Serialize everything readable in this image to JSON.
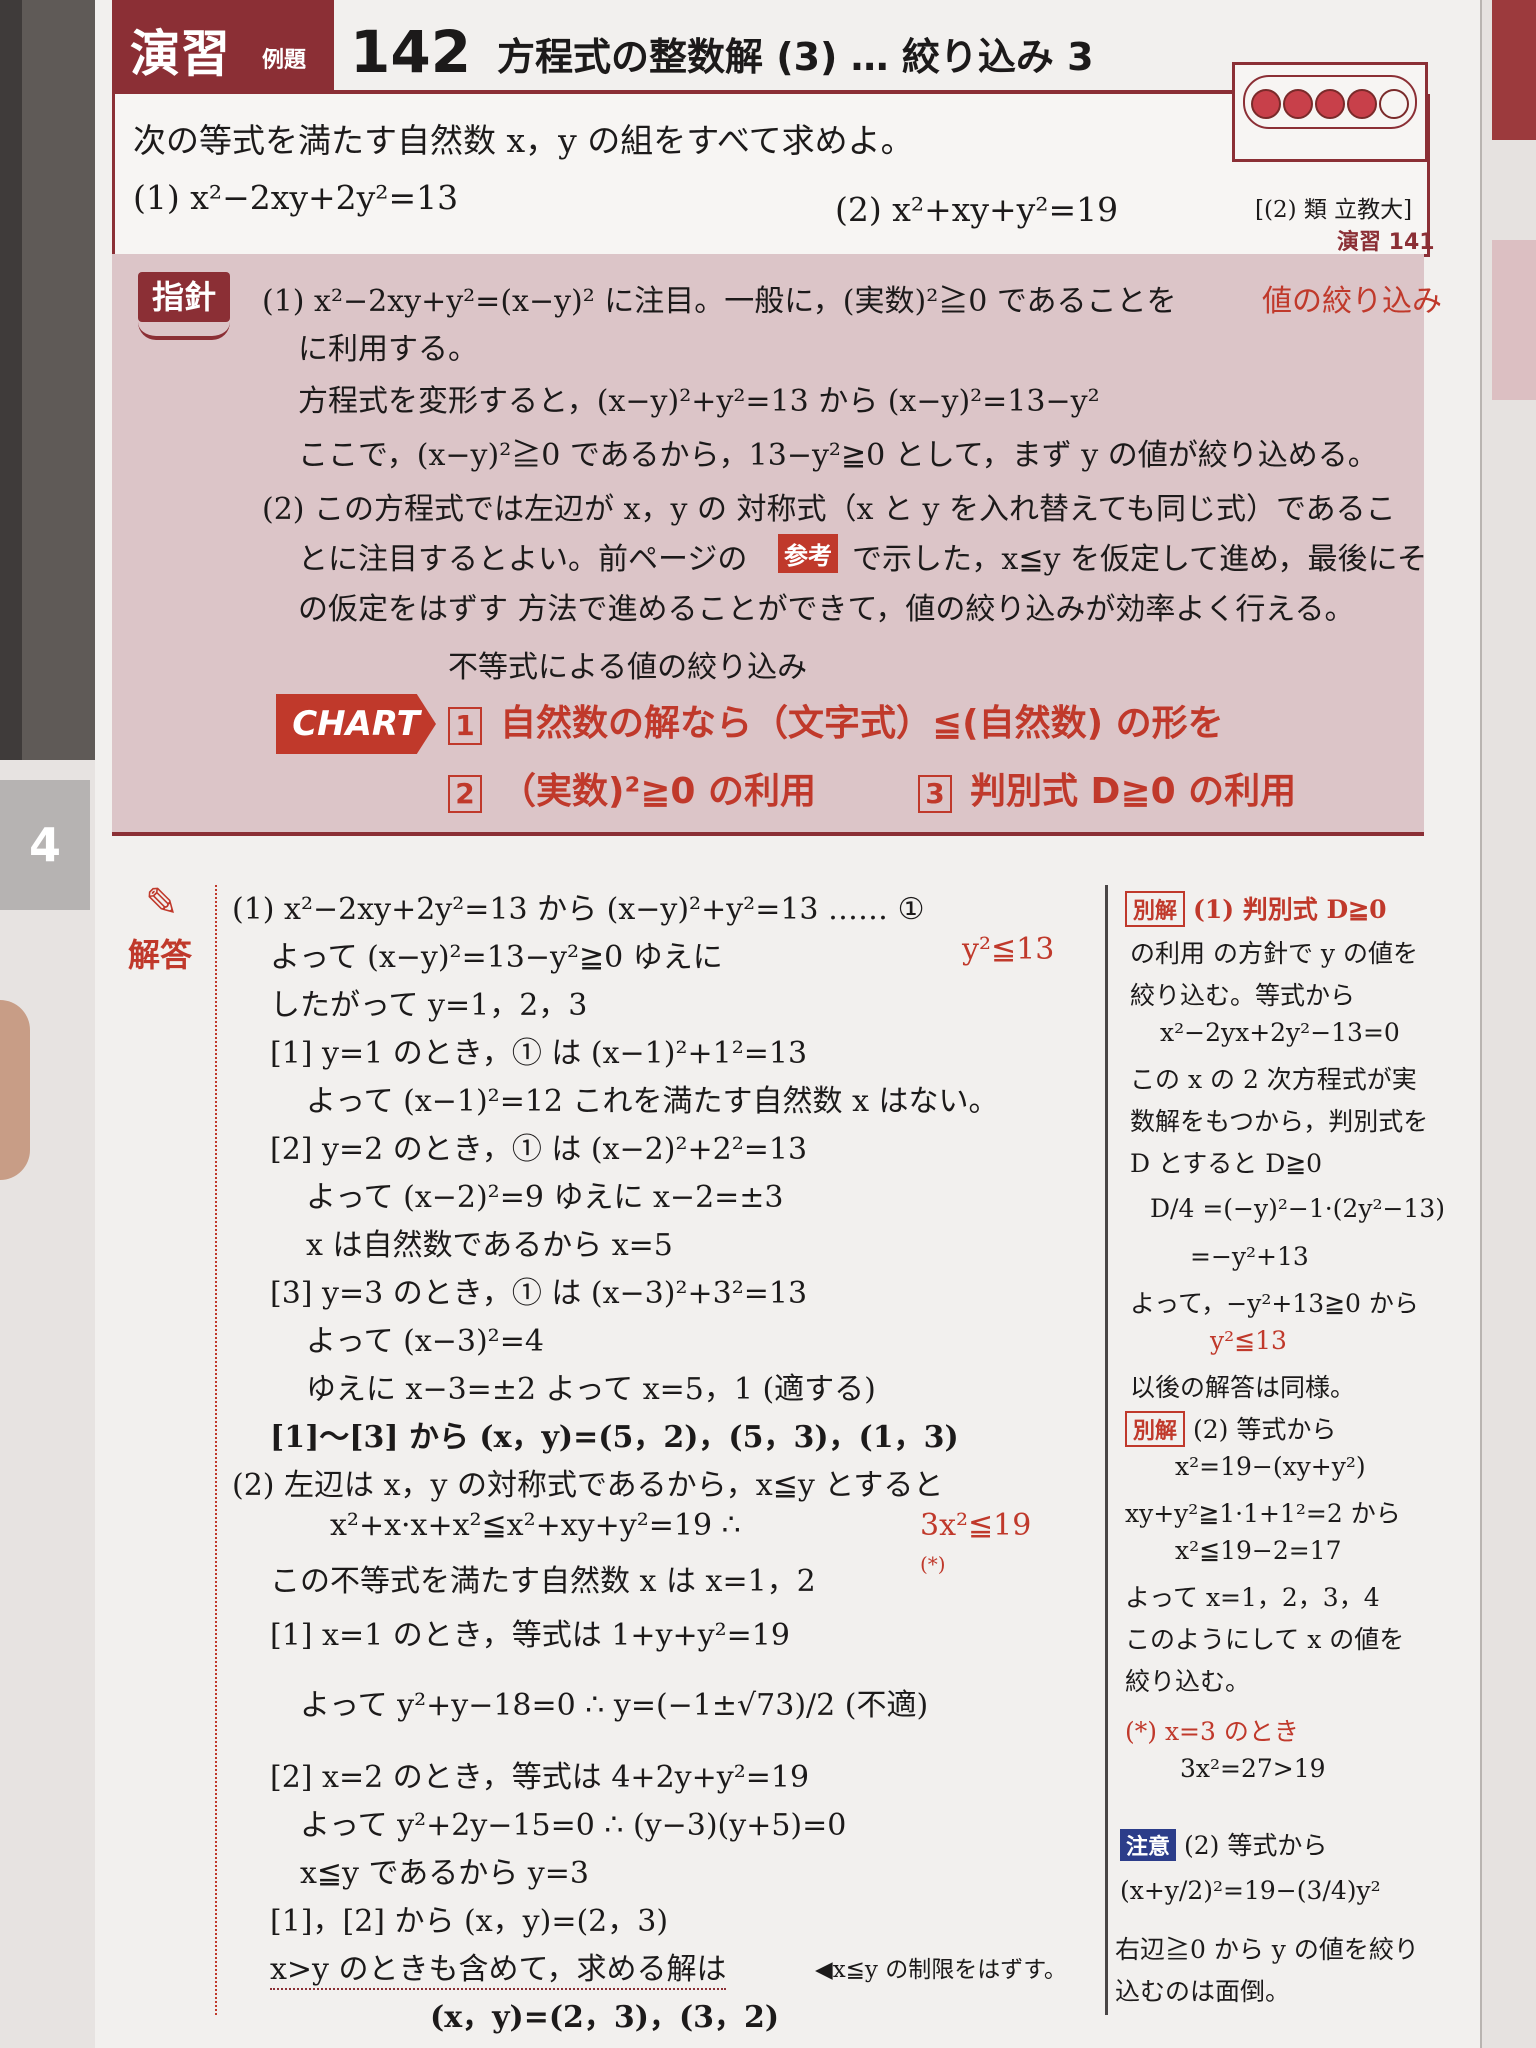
{
  "header": {
    "enshu": "演習",
    "reidai": "例題",
    "number": "142",
    "title": "方程式の整数解 (3) … 絞り込み 3"
  },
  "problem": {
    "intro": "次の等式を満たす自然数 x，y の組をすべて求めよ。",
    "p1": "(1)  x²−2xy+2y²=13",
    "p2": "(2)  x²+xy+y²=19",
    "source": "[(2) 類 立教大]",
    "enshu_ref": "演習 141"
  },
  "shishin": {
    "label": "指針",
    "l1a": "(1)  x²−2xy+y²=(x−y)² に注目。一般に，(実数)²≧0 であることを",
    "l1b": "値の絞り込み",
    "l2": "に利用する。",
    "l3": "方程式を変形すると，(x−y)²+y²=13 から       (x−y)²=13−y²",
    "l4": "ここで，(x−y)²≧0 であるから，13−y²≧0 として，まず y の値が絞り込める。",
    "l5": "(2)  この方程式では左辺が x，y の 対称式（x と y を入れ替えても同じ式）であるこ",
    "l6a": "とに注目するとよい。前ページの",
    "l6tag": "参考",
    "l6b": "で示した，x≦y を仮定して進め，最後にそ",
    "l7": "の仮定をはずす 方法で進めることができて，値の絞り込みが効率よく行える。",
    "chart_title": "不等式による値の絞り込み",
    "chart_label": "CHART",
    "c1num": "1",
    "c1": "自然数の解なら（文字式）≦(自然数) の形を",
    "c2num": "2",
    "c2": "（実数)²≧0 の利用",
    "c3num": "3",
    "c3": "判別式 D≧0 の利用"
  },
  "kaito": {
    "label": "解答",
    "lines": [
      "(1)  x²−2xy+2y²=13 から       (x−y)²+y²=13 …… ①",
      "よって    (x−y)²=13−y²≧0    ゆえに",
      "したがって      y=1，2，3",
      "[1]  y=1 のとき，① は   (x−1)²+1²=13",
      "よって  (x−1)²=12   これを満たす自然数 x はない。",
      "[2]  y=2 のとき，① は   (x−2)²+2²=13",
      "よって  (x−2)²=9      ゆえに   x−2=±3",
      "x は自然数であるから       x=5",
      "[3]  y=3 のとき，① は      (x−3)²+3²=13",
      "よって      (x−3)²=4",
      "ゆえに   x−3=±2      よって   x=5，1  (適する)",
      "[1]～[3] から      (x，y)=(5，2)，(5，3)，(1，3)",
      "(2)  左辺は x，y の対称式であるから，x≦y とすると",
      "x²+x·x+x²≦x²+xy+y²=19       ∴",
      "この不等式を満たす自然数 x は      x=1，2",
      "[1]  x=1 のとき，等式は       1+y+y²=19",
      "よって   y²+y−18=0    ∴   y=(−1±√73)/2  (不適)",
      "[2]  x=2 のとき，等式は       4+2y+y²=19",
      "よって   y²+2y−15=0       ∴   (y−3)(y+5)=0",
      "x≦y であるから        y=3",
      "[1]，[2] から        (x，y)=(2，3)",
      "x>y のときも含めて，求める解は",
      "(x，y)=(2，3)，(3，2)"
    ],
    "red1": "y²≦13",
    "red2": "3x²≦19",
    "star": "(*)",
    "note": "◀x≦y の制限をはずす。"
  },
  "side": {
    "betsukai": "別解",
    "s1": "(1)  判別式 D≧0",
    "s2": "の利用 の方針で y の値を",
    "s3": "絞り込む。等式から",
    "s4": "x²−2yx+2y²−13=0",
    "s5": "この x の 2 次方程式が実",
    "s6": "数解をもつから，判別式を",
    "s7": "D とすると     D≧0",
    "s8": "D/4 =(−y)²−1·(2y²−13)",
    "s9": "=−y²+13",
    "s10": "よって，−y²+13≧0 から",
    "s11": "y²≦13",
    "s12": "以後の解答は同様。",
    "s13": "(2)  等式から",
    "s14": "x²=19−(xy+y²)",
    "s15": "xy+y²≧1·1+1²=2 から",
    "s16": "x²≦19−2=17",
    "s17": "よって    x=1，2，3，4",
    "s18": "このようにして x の値を",
    "s19": "絞り込む。",
    "s20": "(*)  x=3 のとき",
    "s21": "3x²=27>19",
    "chui": "注意",
    "s22": "(2)  等式から",
    "s23": "(x+y/2)²=19−(3/4)y²",
    "s24": "右辺≧0 から y の値を絞り",
    "s25": "込むのは面倒。"
  },
  "colors": {
    "accent": "#8b2f35",
    "red": "#c0392b",
    "pink": "#dcc5c8",
    "navy": "#2c3d8a"
  }
}
